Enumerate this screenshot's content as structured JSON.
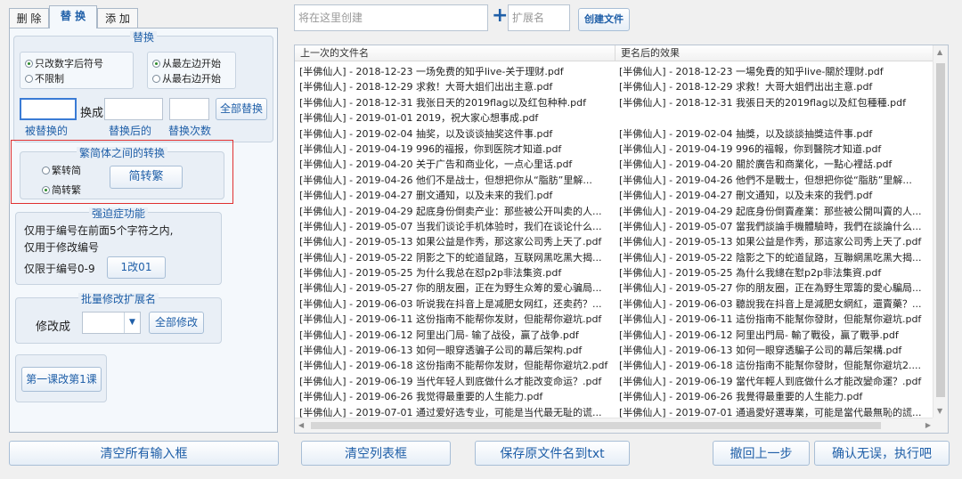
{
  "tabs": [
    "删 除",
    "替 换",
    "添 加"
  ],
  "create": {
    "placeholder": "将在这里创建",
    "plus": "+",
    "ext_placeholder": "扩展名",
    "button": "创建文件"
  },
  "replace": {
    "title": "替换",
    "radio_only_digits": "只改数字后符号",
    "radio_unlimited": "不限制",
    "radio_from_left": "从最左边开始",
    "radio_from_right": "从最右边开始",
    "change_to": "换成",
    "replace_all": "全部替换",
    "label_replaced": "被替换的",
    "label_after": "替换后的",
    "label_count": "替换次数"
  },
  "convert": {
    "title": "繁简体之间的转换",
    "radio_t2s": "繁转简",
    "radio_s2t": "简转繁",
    "button": "简转繁"
  },
  "force": {
    "title": "强迫症功能",
    "line1": "仅用于编号在前面5个字符之内,",
    "line2": "仅用于修改编号",
    "line3": "仅限于编号0-9",
    "button": "1改01"
  },
  "batch_ext": {
    "title": "批量修改扩展名",
    "label": "修改成",
    "button": "全部修改"
  },
  "lesson_button": "第一课改第1课",
  "list": {
    "col1": "上一次的文件名",
    "col2": "更名后的效果",
    "rows": [
      [
        "[半佛仙人] - 2018-12-23 一场免费的知乎live-关于理财.pdf",
        "[半佛仙人] - 2018-12-23 一場免費的知乎live-關於理財.pdf"
      ],
      [
        "[半佛仙人] - 2018-12-29 求救！大哥大姐们出出主意.pdf",
        "[半佛仙人] - 2018-12-29 求救！大哥大姐們出出主意.pdf"
      ],
      [
        "[半佛仙人] - 2018-12-31 我张日天的2019flag以及红包种种.pdf",
        "[半佛仙人] - 2018-12-31 我張日天的2019flag以及紅包種種.pdf"
      ],
      [
        "[半佛仙人] - 2019-01-01 2019，祝大家心想事成.pdf",
        ""
      ],
      [
        "[半佛仙人] - 2019-02-04 抽奖，以及谈谈抽奖这件事.pdf",
        "[半佛仙人] - 2019-02-04 抽獎，以及談談抽獎這件事.pdf"
      ],
      [
        "[半佛仙人] - 2019-04-19 996的福报，你到医院才知道.pdf",
        "[半佛仙人] - 2019-04-19 996的福報，你到醫院才知道.pdf"
      ],
      [
        "[半佛仙人] - 2019-04-20 关于广告和商业化，一点心里话.pdf",
        "[半佛仙人] - 2019-04-20 關於廣告和商業化，一點心裡話.pdf"
      ],
      [
        "[半佛仙人] - 2019-04-26 他们不是战士，但想把你从“脂肪”里解...",
        "[半佛仙人] - 2019-04-26 他們不是戰士，但想把你從“脂肪”里解..."
      ],
      [
        "[半佛仙人] - 2019-04-27 删文通知，以及未来的我们.pdf",
        "[半佛仙人] - 2019-04-27 刪文通知，以及未來的我們.pdf"
      ],
      [
        "[半佛仙人] - 2019-04-29 起底身份倒卖产业：那些被公开叫卖的人...",
        "[半佛仙人] - 2019-04-29 起底身份倒賣產業：那些被公開叫賣的人..."
      ],
      [
        "[半佛仙人] - 2019-05-07 当我们谈论手机体验时，我们在谈论什么...",
        "[半佛仙人] - 2019-05-07 當我們談論手機體驗時，我們在談論什么..."
      ],
      [
        "[半佛仙人] - 2019-05-13 如果公益是作秀，那这家公司秀上天了.pdf",
        "[半佛仙人] - 2019-05-13 如果公益是作秀，那這家公司秀上天了.pdf"
      ],
      [
        "[半佛仙人] - 2019-05-22 阴影之下的蛇道鼠路，互联网黑吃黑大揭...",
        "[半佛仙人] - 2019-05-22 陰影之下的蛇道鼠路，互聯網黑吃黑大揭..."
      ],
      [
        "[半佛仙人] - 2019-05-25 为什么我总在怼p2p非法集资.pdf",
        "[半佛仙人] - 2019-05-25 為什么我總在懟p2p非法集資.pdf"
      ],
      [
        "[半佛仙人] - 2019-05-27 你的朋友圈，正在为野生众筹的爱心骗局...",
        "[半佛仙人] - 2019-05-27 你的朋友圈，正在為野生眾籌的愛心騙局..."
      ],
      [
        "[半佛仙人] - 2019-06-03 听说我在抖音上是减肥女网红，还卖药？...",
        "[半佛仙人] - 2019-06-03 聽說我在抖音上是減肥女網紅，還賣藥？..."
      ],
      [
        "[半佛仙人] - 2019-06-11 这份指南不能帮你发财，但能帮你避坑.pdf",
        "[半佛仙人] - 2019-06-11 這份指南不能幫你發財，但能幫你避坑.pdf"
      ],
      [
        "[半佛仙人] - 2019-06-12 阿里出门局- 输了战役，赢了战争.pdf",
        "[半佛仙人] - 2019-06-12 阿里出門局- 輸了戰役，贏了戰爭.pdf"
      ],
      [
        "[半佛仙人] - 2019-06-13 如何一眼穿透骗子公司的幕后架构.pdf",
        "[半佛仙人] - 2019-06-13 如何一眼穿透騙子公司的幕后架構.pdf"
      ],
      [
        "[半佛仙人] - 2019-06-18 这份指南不能帮你发财，但能帮你避坑2.pdf",
        "[半佛仙人] - 2019-06-18 這份指南不能幫你發財，但能幫你避坑2...."
      ],
      [
        "[半佛仙人] - 2019-06-19 当代年轻人到底做什么才能改变命运？.pdf",
        "[半佛仙人] - 2019-06-19 當代年輕人到底做什么才能改變命運？.pdf"
      ],
      [
        "[半佛仙人] - 2019-06-26 我觉得最重要的人生能力.pdf",
        "[半佛仙人] - 2019-06-26 我覺得最重要的人生能力.pdf"
      ],
      [
        "[半佛仙人] - 2019-07-01 通过爱好选专业，可能是当代最无耻的谎...",
        "[半佛仙人] - 2019-07-01 通過愛好選專業，可能是當代最無恥的謊..."
      ]
    ]
  },
  "bottom": {
    "clear_inputs": "清空所有输入框",
    "clear_list": "清空列表框",
    "save_txt": "保存原文件名到txt",
    "undo": "撤回上一步",
    "confirm": "确认无误，执行吧"
  },
  "colors": {
    "accent": "#1f5fa8",
    "highlight_border": "#e03030",
    "radio_on": "#2a8a2a"
  }
}
